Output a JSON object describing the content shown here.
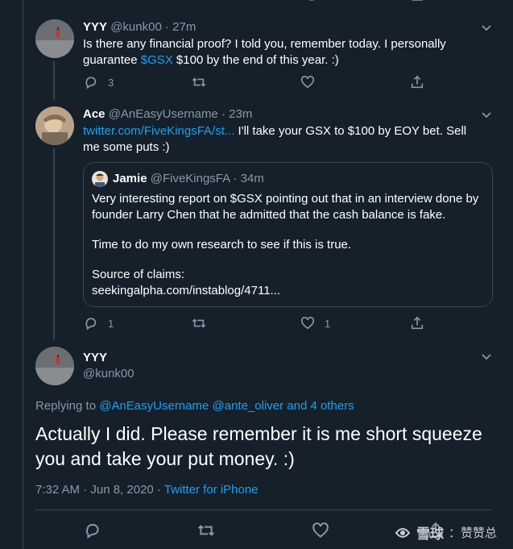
{
  "tweet1": {
    "name": "YYY",
    "handle": "@kunk00",
    "sep": "·",
    "time": "27m",
    "text_before": "Is there any financial proof? I told you, remember today. I personally guarantee ",
    "cashtag": "$GSX",
    "text_after": " $100 by the end of this year. :)",
    "reply_count": "3",
    "retweet_count": "",
    "like_count": ""
  },
  "tweet2": {
    "name": "Ace",
    "handle": "@AnEasyUsername",
    "sep": "·",
    "time": "23m",
    "link": "twitter.com/FiveKingsFA/st...",
    "text": " I'll take your GSX to $100 by EOY bet. Sell me some puts :)",
    "reply_count": "1",
    "retweet_count": "",
    "like_count": "1",
    "quote": {
      "name": "Jamie",
      "handle": "@FiveKingsFA",
      "sep": "·",
      "time": "34m",
      "para1": "Very interesting report on $GSX pointing out that in an interview done by founder Larry Chen that he admitted that the cash balance is fake.",
      "para2": "Time to do my own research to see if this is true.",
      "para3_line1": "Source of claims:",
      "para3_line2": "seekingalpha.com/instablog/4711..."
    }
  },
  "tweet3": {
    "name": "YYY",
    "handle": "@kunk00",
    "replying_prefix": "Replying to ",
    "replying_users": "@AnEasyUsername @ante_oliver",
    "replying_and": " and ",
    "replying_others": "4 others",
    "text": "Actually I did. Please remember it is me short squeeze you and take your put money. :)",
    "timestamp": "7:32 AM · Jun 8, 2020 · ",
    "client": "Twitter for iPhone"
  },
  "watermark": {
    "brand": "雪球",
    "suffix": "：赞赞总"
  },
  "colors": {
    "background": "#15202b",
    "link": "#1da1f2",
    "muted": "#8899a6",
    "border": "#38444d"
  }
}
